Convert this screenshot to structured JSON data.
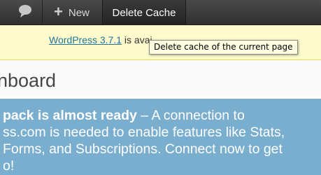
{
  "admin_bar": {
    "comments_icon": "speech-bubble-icon",
    "new_label": "New",
    "new_icon": "plus-icon",
    "delete_cache_label": "Delete Cache"
  },
  "update_nag": {
    "version_link": "WordPress 3.7.1",
    "text_after": "is avai"
  },
  "tooltip": {
    "text": "Delete cache of the current page"
  },
  "page": {
    "title": "nboard"
  },
  "jetpack_banner": {
    "heading_bold": "pack is almost ready",
    "line1_rest": " – A connection to",
    "line2": "ss.com is needed to enable features like Stats,",
    "line3": "Forms, and Subscriptions. Connect now to get",
    "line4": "o!"
  },
  "colors": {
    "admin_bar": "#464646",
    "nag_background": "#fffbcc",
    "link": "#21759b",
    "banner_background": "#79aecf"
  }
}
